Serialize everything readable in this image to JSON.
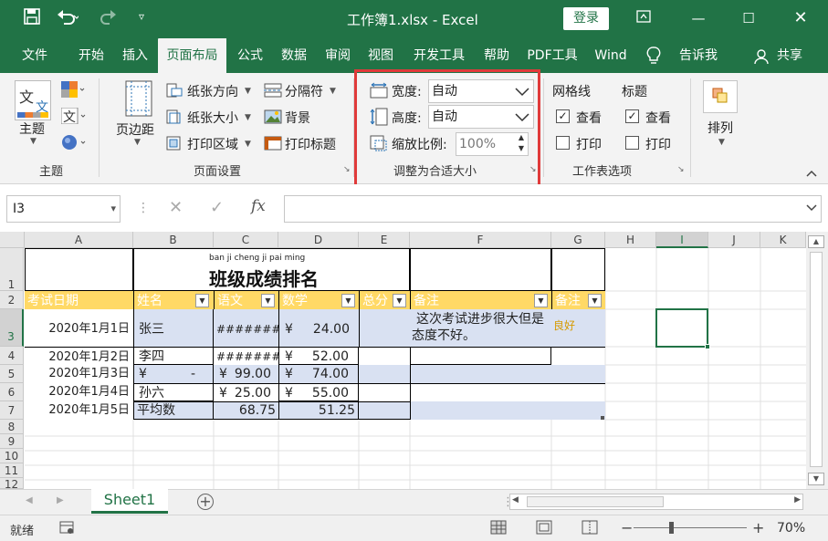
{
  "titlebar": {
    "title": "工作簿1.xlsx  -  Excel",
    "login_label": "登录"
  },
  "tabs": [
    "文件",
    "开始",
    "插入",
    "页面布局",
    "公式",
    "数据",
    "审阅",
    "视图",
    "开发工具",
    "帮助",
    "PDF工具",
    "Wind",
    "告诉我",
    "共享"
  ],
  "ribbon": {
    "themes": {
      "theme_label": "主题",
      "group_label": "主题"
    },
    "page_setup": {
      "margins_label": "页边距",
      "orientation_label": "纸张方向",
      "size_label": "纸张大小",
      "print_area_label": "打印区域",
      "breaks_label": "分隔符",
      "background_label": "背景",
      "print_titles_label": "打印标题",
      "group_label": "页面设置"
    },
    "scale_to_fit": {
      "width_label": "宽度:",
      "width_value": "自动",
      "height_label": "高度:",
      "height_value": "自动",
      "scale_label": "缩放比例:",
      "scale_value": "100%",
      "group_label": "调整为合适大小"
    },
    "sheet_options": {
      "gridlines_label": "网格线",
      "headings_label": "标题",
      "view_label": "查看",
      "print_label": "打印",
      "group_label": "工作表选项"
    },
    "arrange": {
      "label": "排列"
    }
  },
  "formula_bar": {
    "name_box": "I3",
    "fx_label": "fx",
    "content": ""
  },
  "columns": [
    "A",
    "B",
    "C",
    "D",
    "E",
    "F",
    "G",
    "H",
    "I",
    "J",
    "K"
  ],
  "rows": [
    "1",
    "2",
    "3",
    "4",
    "5",
    "6",
    "7",
    "8",
    "9",
    "10",
    "11",
    "12"
  ],
  "sheet_title": {
    "pinyin": "ban ji cheng ji pai ming",
    "text": "班级成绩排名"
  },
  "table_headers": [
    "考试日期",
    "姓名",
    "语文",
    "数学",
    "总分",
    "备注",
    "备注"
  ],
  "table_rows": [
    {
      "date": "2020年1月1日",
      "name": "张三",
      "chinese": "########",
      "math_sym": "¥",
      "math": "24.00",
      "note": "这次考试进步很大但是态度不好。",
      "note2": "良好"
    },
    {
      "date": "2020年1月2日",
      "name": "李四",
      "chinese": "########",
      "math_sym": "¥",
      "math": "52.00",
      "note": "",
      "note2": ""
    },
    {
      "date": "2020年1月3日",
      "name": "¥",
      "name_extra": "-",
      "chinese_sym": "¥",
      "chinese": "99.00",
      "math_sym": "¥",
      "math": "74.00",
      "note": "",
      "note2": ""
    },
    {
      "date": "2020年1月4日",
      "name": "孙六",
      "chinese_sym": "¥",
      "chinese": "25.00",
      "math_sym": "¥",
      "math": "55.00",
      "note": "",
      "note2": ""
    },
    {
      "date": "2020年1月5日",
      "name": "平均数",
      "chinese": "68.75",
      "math": "51.25",
      "note": "",
      "note2": ""
    }
  ],
  "sheet_tabs": [
    "Sheet1"
  ],
  "status": {
    "ready": "就绪",
    "zoom": "70%"
  },
  "colors": {
    "excel_green": "#217346",
    "header_yellow": "#ffd966",
    "band_blue": "#d9e1f2",
    "highlight_red": "#e03a3a"
  }
}
